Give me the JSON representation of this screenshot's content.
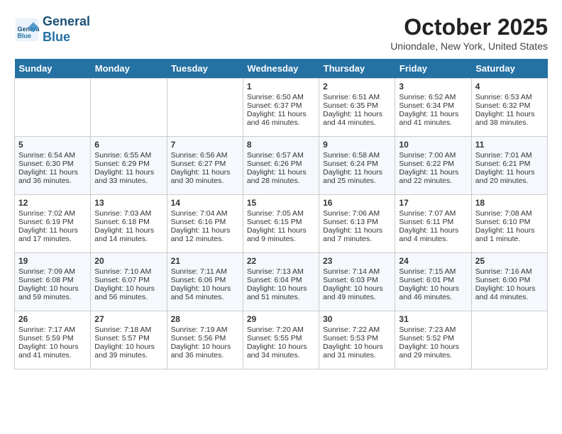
{
  "header": {
    "logo_line1": "General",
    "logo_line2": "Blue",
    "month": "October 2025",
    "location": "Uniondale, New York, United States"
  },
  "days_of_week": [
    "Sunday",
    "Monday",
    "Tuesday",
    "Wednesday",
    "Thursday",
    "Friday",
    "Saturday"
  ],
  "weeks": [
    [
      {
        "day": "",
        "empty": true
      },
      {
        "day": "",
        "empty": true
      },
      {
        "day": "",
        "empty": true
      },
      {
        "day": "1",
        "sunrise": "6:50 AM",
        "sunset": "6:37 PM",
        "daylight": "11 hours and 46 minutes."
      },
      {
        "day": "2",
        "sunrise": "6:51 AM",
        "sunset": "6:35 PM",
        "daylight": "11 hours and 44 minutes."
      },
      {
        "day": "3",
        "sunrise": "6:52 AM",
        "sunset": "6:34 PM",
        "daylight": "11 hours and 41 minutes."
      },
      {
        "day": "4",
        "sunrise": "6:53 AM",
        "sunset": "6:32 PM",
        "daylight": "11 hours and 38 minutes."
      }
    ],
    [
      {
        "day": "5",
        "sunrise": "6:54 AM",
        "sunset": "6:30 PM",
        "daylight": "11 hours and 36 minutes."
      },
      {
        "day": "6",
        "sunrise": "6:55 AM",
        "sunset": "6:29 PM",
        "daylight": "11 hours and 33 minutes."
      },
      {
        "day": "7",
        "sunrise": "6:56 AM",
        "sunset": "6:27 PM",
        "daylight": "11 hours and 30 minutes."
      },
      {
        "day": "8",
        "sunrise": "6:57 AM",
        "sunset": "6:26 PM",
        "daylight": "11 hours and 28 minutes."
      },
      {
        "day": "9",
        "sunrise": "6:58 AM",
        "sunset": "6:24 PM",
        "daylight": "11 hours and 25 minutes."
      },
      {
        "day": "10",
        "sunrise": "7:00 AM",
        "sunset": "6:22 PM",
        "daylight": "11 hours and 22 minutes."
      },
      {
        "day": "11",
        "sunrise": "7:01 AM",
        "sunset": "6:21 PM",
        "daylight": "11 hours and 20 minutes."
      }
    ],
    [
      {
        "day": "12",
        "sunrise": "7:02 AM",
        "sunset": "6:19 PM",
        "daylight": "11 hours and 17 minutes."
      },
      {
        "day": "13",
        "sunrise": "7:03 AM",
        "sunset": "6:18 PM",
        "daylight": "11 hours and 14 minutes."
      },
      {
        "day": "14",
        "sunrise": "7:04 AM",
        "sunset": "6:16 PM",
        "daylight": "11 hours and 12 minutes."
      },
      {
        "day": "15",
        "sunrise": "7:05 AM",
        "sunset": "6:15 PM",
        "daylight": "11 hours and 9 minutes."
      },
      {
        "day": "16",
        "sunrise": "7:06 AM",
        "sunset": "6:13 PM",
        "daylight": "11 hours and 7 minutes."
      },
      {
        "day": "17",
        "sunrise": "7:07 AM",
        "sunset": "6:11 PM",
        "daylight": "11 hours and 4 minutes."
      },
      {
        "day": "18",
        "sunrise": "7:08 AM",
        "sunset": "6:10 PM",
        "daylight": "11 hours and 1 minute."
      }
    ],
    [
      {
        "day": "19",
        "sunrise": "7:09 AM",
        "sunset": "6:08 PM",
        "daylight": "10 hours and 59 minutes."
      },
      {
        "day": "20",
        "sunrise": "7:10 AM",
        "sunset": "6:07 PM",
        "daylight": "10 hours and 56 minutes."
      },
      {
        "day": "21",
        "sunrise": "7:11 AM",
        "sunset": "6:06 PM",
        "daylight": "10 hours and 54 minutes."
      },
      {
        "day": "22",
        "sunrise": "7:13 AM",
        "sunset": "6:04 PM",
        "daylight": "10 hours and 51 minutes."
      },
      {
        "day": "23",
        "sunrise": "7:14 AM",
        "sunset": "6:03 PM",
        "daylight": "10 hours and 49 minutes."
      },
      {
        "day": "24",
        "sunrise": "7:15 AM",
        "sunset": "6:01 PM",
        "daylight": "10 hours and 46 minutes."
      },
      {
        "day": "25",
        "sunrise": "7:16 AM",
        "sunset": "6:00 PM",
        "daylight": "10 hours and 44 minutes."
      }
    ],
    [
      {
        "day": "26",
        "sunrise": "7:17 AM",
        "sunset": "5:59 PM",
        "daylight": "10 hours and 41 minutes."
      },
      {
        "day": "27",
        "sunrise": "7:18 AM",
        "sunset": "5:57 PM",
        "daylight": "10 hours and 39 minutes."
      },
      {
        "day": "28",
        "sunrise": "7:19 AM",
        "sunset": "5:56 PM",
        "daylight": "10 hours and 36 minutes."
      },
      {
        "day": "29",
        "sunrise": "7:20 AM",
        "sunset": "5:55 PM",
        "daylight": "10 hours and 34 minutes."
      },
      {
        "day": "30",
        "sunrise": "7:22 AM",
        "sunset": "5:53 PM",
        "daylight": "10 hours and 31 minutes."
      },
      {
        "day": "31",
        "sunrise": "7:23 AM",
        "sunset": "5:52 PM",
        "daylight": "10 hours and 29 minutes."
      },
      {
        "day": "",
        "empty": true
      }
    ]
  ]
}
